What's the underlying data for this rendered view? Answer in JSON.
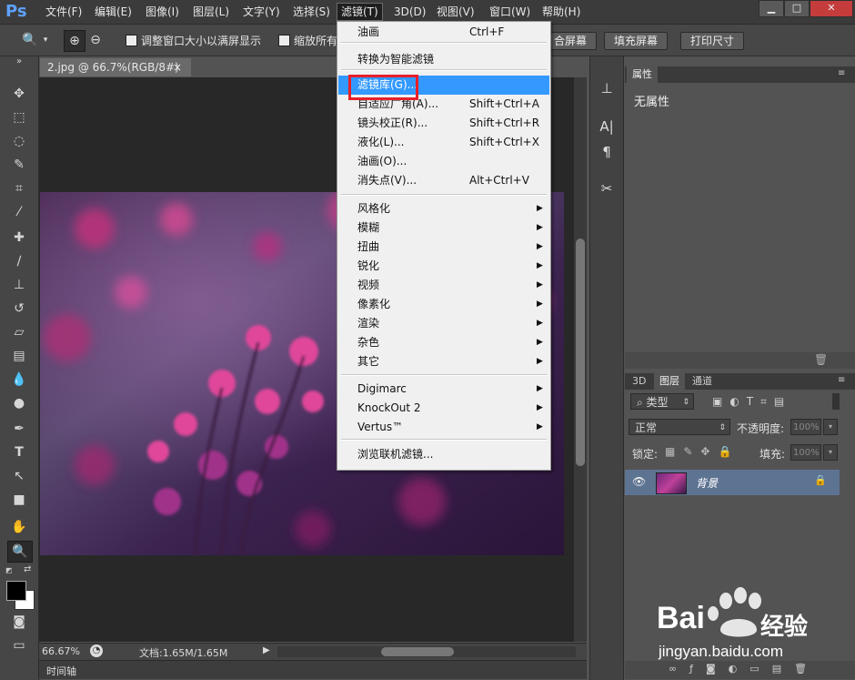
{
  "app": {
    "logo": "Ps"
  },
  "menubar": {
    "items": [
      "文件(F)",
      "编辑(E)",
      "图像(I)",
      "图层(L)",
      "文字(Y)",
      "选择(S)",
      "滤镜(T)",
      "3D(D)",
      "视图(V)",
      "窗口(W)",
      "帮助(H)"
    ],
    "active": "滤镜(T)"
  },
  "options": {
    "resize_windows_label": "调整窗口大小以满屏显示",
    "zoom_all_label": "缩放所有",
    "fit_screen_btn": "合屏幕",
    "fill_screen_btn": "填充屏幕",
    "print_size_btn": "打印尺寸"
  },
  "document": {
    "tab_title": "2.jpg @ 66.7%(RGB/8#)",
    "tab_close": "×",
    "zoom": "66.67%",
    "doc_info": "文档:1.65M/1.65M"
  },
  "timeline": {
    "label": "时间轴"
  },
  "properties": {
    "tab": "属性",
    "content": "无属性"
  },
  "layers": {
    "tabs": [
      "3D",
      "图层",
      "通道"
    ],
    "active_tab": "图层",
    "filter_kind": "类型",
    "blend_mode": "正常",
    "opacity_label": "不透明度:",
    "opacity_value": "100%",
    "lock_label": "锁定:",
    "fill_label": "填充:",
    "fill_value": "100%",
    "layer_name": "背景"
  },
  "filter_menu": {
    "groups": [
      [
        {
          "label": "油画",
          "shortcut": "Ctrl+F"
        }
      ],
      [
        {
          "label": "转换为智能滤镜"
        }
      ],
      [
        {
          "label": "滤镜库(G)...",
          "highlight": true
        },
        {
          "label": "自适应广角(A)...",
          "shortcut": "Shift+Ctrl+A"
        },
        {
          "label": "镜头校正(R)...",
          "shortcut": "Shift+Ctrl+R"
        },
        {
          "label": "液化(L)...",
          "shortcut": "Shift+Ctrl+X"
        },
        {
          "label": "油画(O)..."
        },
        {
          "label": "消失点(V)...",
          "shortcut": "Alt+Ctrl+V"
        }
      ],
      [
        {
          "label": "风格化",
          "submenu": true
        },
        {
          "label": "模糊",
          "submenu": true
        },
        {
          "label": "扭曲",
          "submenu": true
        },
        {
          "label": "锐化",
          "submenu": true
        },
        {
          "label": "视频",
          "submenu": true
        },
        {
          "label": "像素化",
          "submenu": true
        },
        {
          "label": "渲染",
          "submenu": true
        },
        {
          "label": "杂色",
          "submenu": true
        },
        {
          "label": "其它",
          "submenu": true
        }
      ],
      [
        {
          "label": "Digimarc",
          "submenu": true
        },
        {
          "label": "KnockOut 2",
          "submenu": true
        },
        {
          "label": "Vertus™",
          "submenu": true
        }
      ],
      [
        {
          "label": "浏览联机滤镜..."
        }
      ]
    ]
  },
  "watermark": {
    "brand": "Bai",
    "brand2": "经验",
    "url": "jingyan.baidu.com"
  },
  "colors": {
    "menu_highlight": "#3399ff",
    "red_box": "#e8202a",
    "layer_selected": "#5d7392"
  }
}
